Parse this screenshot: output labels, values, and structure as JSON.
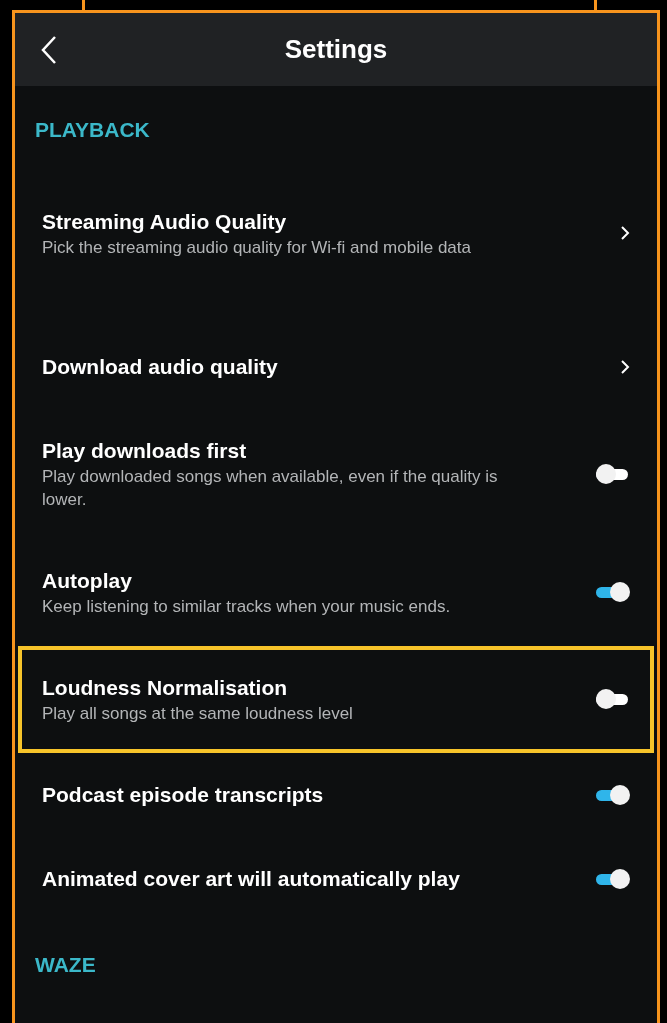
{
  "header": {
    "title": "Settings"
  },
  "sections": [
    {
      "title": "PLAYBACK",
      "items": [
        {
          "kind": "link",
          "title": "Streaming Audio Quality",
          "subtitle": "Pick the streaming audio quality for Wi-fi and mobile data",
          "highlighted": false
        },
        {
          "kind": "link",
          "title": "Download audio quality",
          "highlighted": false
        },
        {
          "kind": "toggle",
          "title": "Play downloads first",
          "subtitle": "Play downloaded songs when available, even if the quality is lower.",
          "on": false,
          "highlighted": false
        },
        {
          "kind": "toggle",
          "title": "Autoplay",
          "subtitle": "Keep listening to similar tracks when your music ends.",
          "on": true,
          "highlighted": false
        },
        {
          "kind": "toggle",
          "title": "Loudness Normalisation",
          "subtitle": "Play all songs at the same loudness level",
          "on": false,
          "highlighted": true
        },
        {
          "kind": "toggle",
          "title": "Podcast episode transcripts",
          "on": true,
          "highlighted": false
        },
        {
          "kind": "toggle",
          "title": "Animated cover art will automatically play",
          "on": true,
          "highlighted": false
        }
      ]
    },
    {
      "title": "WAZE"
    }
  ]
}
